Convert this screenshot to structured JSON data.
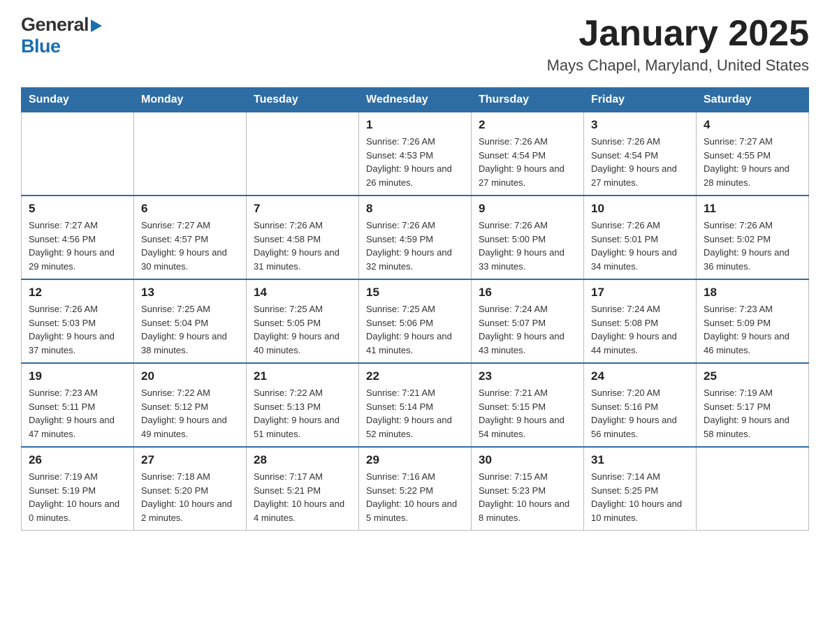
{
  "header": {
    "logo_general": "General",
    "logo_blue": "Blue",
    "month_year": "January 2025",
    "location": "Mays Chapel, Maryland, United States"
  },
  "days_of_week": [
    "Sunday",
    "Monday",
    "Tuesday",
    "Wednesday",
    "Thursday",
    "Friday",
    "Saturday"
  ],
  "weeks": [
    {
      "days": [
        {
          "number": "",
          "info": ""
        },
        {
          "number": "",
          "info": ""
        },
        {
          "number": "",
          "info": ""
        },
        {
          "number": "1",
          "info": "Sunrise: 7:26 AM\nSunset: 4:53 PM\nDaylight: 9 hours\nand 26 minutes."
        },
        {
          "number": "2",
          "info": "Sunrise: 7:26 AM\nSunset: 4:54 PM\nDaylight: 9 hours\nand 27 minutes."
        },
        {
          "number": "3",
          "info": "Sunrise: 7:26 AM\nSunset: 4:54 PM\nDaylight: 9 hours\nand 27 minutes."
        },
        {
          "number": "4",
          "info": "Sunrise: 7:27 AM\nSunset: 4:55 PM\nDaylight: 9 hours\nand 28 minutes."
        }
      ]
    },
    {
      "days": [
        {
          "number": "5",
          "info": "Sunrise: 7:27 AM\nSunset: 4:56 PM\nDaylight: 9 hours\nand 29 minutes."
        },
        {
          "number": "6",
          "info": "Sunrise: 7:27 AM\nSunset: 4:57 PM\nDaylight: 9 hours\nand 30 minutes."
        },
        {
          "number": "7",
          "info": "Sunrise: 7:26 AM\nSunset: 4:58 PM\nDaylight: 9 hours\nand 31 minutes."
        },
        {
          "number": "8",
          "info": "Sunrise: 7:26 AM\nSunset: 4:59 PM\nDaylight: 9 hours\nand 32 minutes."
        },
        {
          "number": "9",
          "info": "Sunrise: 7:26 AM\nSunset: 5:00 PM\nDaylight: 9 hours\nand 33 minutes."
        },
        {
          "number": "10",
          "info": "Sunrise: 7:26 AM\nSunset: 5:01 PM\nDaylight: 9 hours\nand 34 minutes."
        },
        {
          "number": "11",
          "info": "Sunrise: 7:26 AM\nSunset: 5:02 PM\nDaylight: 9 hours\nand 36 minutes."
        }
      ]
    },
    {
      "days": [
        {
          "number": "12",
          "info": "Sunrise: 7:26 AM\nSunset: 5:03 PM\nDaylight: 9 hours\nand 37 minutes."
        },
        {
          "number": "13",
          "info": "Sunrise: 7:25 AM\nSunset: 5:04 PM\nDaylight: 9 hours\nand 38 minutes."
        },
        {
          "number": "14",
          "info": "Sunrise: 7:25 AM\nSunset: 5:05 PM\nDaylight: 9 hours\nand 40 minutes."
        },
        {
          "number": "15",
          "info": "Sunrise: 7:25 AM\nSunset: 5:06 PM\nDaylight: 9 hours\nand 41 minutes."
        },
        {
          "number": "16",
          "info": "Sunrise: 7:24 AM\nSunset: 5:07 PM\nDaylight: 9 hours\nand 43 minutes."
        },
        {
          "number": "17",
          "info": "Sunrise: 7:24 AM\nSunset: 5:08 PM\nDaylight: 9 hours\nand 44 minutes."
        },
        {
          "number": "18",
          "info": "Sunrise: 7:23 AM\nSunset: 5:09 PM\nDaylight: 9 hours\nand 46 minutes."
        }
      ]
    },
    {
      "days": [
        {
          "number": "19",
          "info": "Sunrise: 7:23 AM\nSunset: 5:11 PM\nDaylight: 9 hours\nand 47 minutes."
        },
        {
          "number": "20",
          "info": "Sunrise: 7:22 AM\nSunset: 5:12 PM\nDaylight: 9 hours\nand 49 minutes."
        },
        {
          "number": "21",
          "info": "Sunrise: 7:22 AM\nSunset: 5:13 PM\nDaylight: 9 hours\nand 51 minutes."
        },
        {
          "number": "22",
          "info": "Sunrise: 7:21 AM\nSunset: 5:14 PM\nDaylight: 9 hours\nand 52 minutes."
        },
        {
          "number": "23",
          "info": "Sunrise: 7:21 AM\nSunset: 5:15 PM\nDaylight: 9 hours\nand 54 minutes."
        },
        {
          "number": "24",
          "info": "Sunrise: 7:20 AM\nSunset: 5:16 PM\nDaylight: 9 hours\nand 56 minutes."
        },
        {
          "number": "25",
          "info": "Sunrise: 7:19 AM\nSunset: 5:17 PM\nDaylight: 9 hours\nand 58 minutes."
        }
      ]
    },
    {
      "days": [
        {
          "number": "26",
          "info": "Sunrise: 7:19 AM\nSunset: 5:19 PM\nDaylight: 10 hours\nand 0 minutes."
        },
        {
          "number": "27",
          "info": "Sunrise: 7:18 AM\nSunset: 5:20 PM\nDaylight: 10 hours\nand 2 minutes."
        },
        {
          "number": "28",
          "info": "Sunrise: 7:17 AM\nSunset: 5:21 PM\nDaylight: 10 hours\nand 4 minutes."
        },
        {
          "number": "29",
          "info": "Sunrise: 7:16 AM\nSunset: 5:22 PM\nDaylight: 10 hours\nand 5 minutes."
        },
        {
          "number": "30",
          "info": "Sunrise: 7:15 AM\nSunset: 5:23 PM\nDaylight: 10 hours\nand 8 minutes."
        },
        {
          "number": "31",
          "info": "Sunrise: 7:14 AM\nSunset: 5:25 PM\nDaylight: 10 hours\nand 10 minutes."
        },
        {
          "number": "",
          "info": ""
        }
      ]
    }
  ]
}
